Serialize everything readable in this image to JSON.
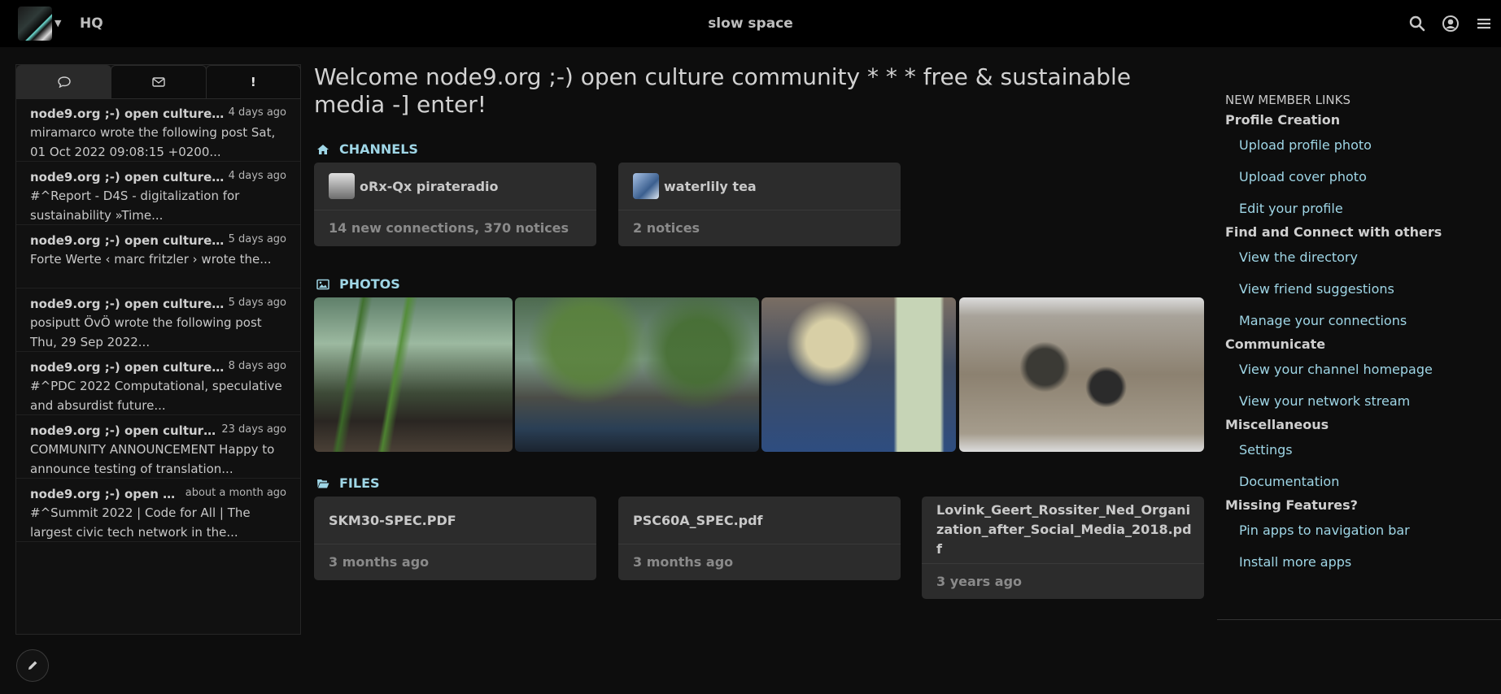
{
  "navbar": {
    "title": "HQ",
    "center_title": "slow space",
    "icons": [
      "search-icon",
      "user-icon",
      "menu-icon"
    ]
  },
  "notifications": {
    "tabs": [
      "chat-icon",
      "mail-icon",
      "alert-icon"
    ],
    "items": [
      {
        "name": "node9.org ;-) open culture co...",
        "time": "4 days ago",
        "body": "miramarco wrote the following post Sat, 01 Oct 2022 09:08:15 +0200..."
      },
      {
        "name": "node9.org ;-) open culture co...",
        "time": "4 days ago",
        "body": "#^Report - D4S - digitalization for sustainability »Time..."
      },
      {
        "name": "node9.org ;-) open culture co...",
        "time": "5 days ago",
        "body": "Forte Werte ‹ marc fritzler › wrote the..."
      },
      {
        "name": "node9.org ;-) open culture co...",
        "time": "5 days ago",
        "body": "posiputt ÖvÖ wrote the following post Thu, 29 Sep 2022..."
      },
      {
        "name": "node9.org ;-) open culture co...",
        "time": "8 days ago",
        "body": "#^PDC 2022 Computational, speculative and absurdist future..."
      },
      {
        "name": "node9.org ;-) open culture co...",
        "time": "23 days ago",
        "body": "COMMUNITY ANNOUNCEMENT Happy to announce testing of translation..."
      },
      {
        "name": "node9.org ;-) open cult...",
        "time": "about a month ago",
        "body": "#^Summit 2022 | Code for All | The largest civic tech network in the..."
      }
    ]
  },
  "main": {
    "welcome": "Welcome node9.org ;-) open culture community * * * free & sustainable media -] enter!",
    "channels": {
      "heading": "CHANNELS",
      "items": [
        {
          "name": "oRx-Qx pirateradio",
          "stats": "14 new connections, 370 notices"
        },
        {
          "name": "waterlily tea",
          "stats": "2 notices"
        }
      ]
    },
    "photos": {
      "heading": "PHOTOS"
    },
    "files": {
      "heading": "FILES",
      "items": [
        {
          "name": "SKM30-SPEC.PDF",
          "age": "3 months ago"
        },
        {
          "name": "PSC60A_SPEC.pdf",
          "age": "3 months ago"
        },
        {
          "name": "Lovink_Geert_Rossiter_Ned_Organization_after_Social_Media_2018.pdf",
          "age": "3 years ago"
        }
      ]
    }
  },
  "sidebar": {
    "heading": "NEW MEMBER LINKS",
    "groups": [
      {
        "title": "Profile Creation",
        "links": [
          "Upload profile photo",
          "Upload cover photo",
          "Edit your profile"
        ]
      },
      {
        "title": "Find and Connect with others",
        "links": [
          "View the directory",
          "View friend suggestions",
          "Manage your connections"
        ]
      },
      {
        "title": "Communicate",
        "links": [
          "View your channel homepage",
          "View your network stream"
        ]
      },
      {
        "title": "Miscellaneous",
        "links": [
          "Settings",
          "Documentation"
        ]
      },
      {
        "title": "Missing Features?",
        "links": [
          "Pin apps to navigation bar",
          "Install more apps"
        ]
      }
    ]
  },
  "colors": {
    "accent": "#9fd6e6",
    "background": "#0d0d0d",
    "card": "#2c2c2c"
  }
}
